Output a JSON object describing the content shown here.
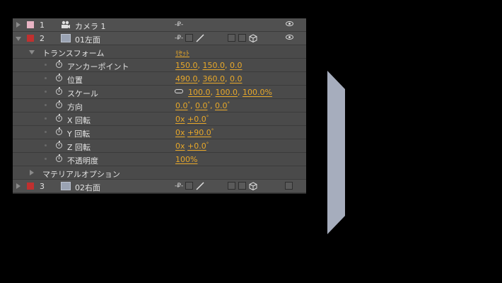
{
  "layers": [
    {
      "num": "1",
      "name": "カメラ 1",
      "label_color": "#e8b4c4"
    },
    {
      "num": "2",
      "name": "01左面",
      "label_color": "#c0302f"
    },
    {
      "num": "3",
      "name": "02右面",
      "label_color": "#c0302f"
    }
  ],
  "transform": {
    "group_label": "トランスフォーム",
    "reset_label": "ﾘｾｯﾄ",
    "anchor": {
      "label": "アンカーポイント",
      "x": "150.0",
      "y": "150.0",
      "z": "0.0"
    },
    "position": {
      "label": "位置",
      "x": "490.0",
      "y": "360.0",
      "z": "0.0"
    },
    "scale": {
      "label": "スケール",
      "x": "100.0",
      "y": "100.0",
      "z": "100.0%"
    },
    "orientation": {
      "label": "方向",
      "x": "0.0",
      "y": "0.0",
      "z": "0.0"
    },
    "xrot": {
      "label": "X 回転",
      "turns": "0x",
      "deg": "+0.0"
    },
    "yrot": {
      "label": "Y 回転",
      "turns": "0x",
      "deg": "+90.0"
    },
    "zrot": {
      "label": "Z 回転",
      "turns": "0x",
      "deg": "+0.0"
    },
    "opacity": {
      "label": "不透明度",
      "value": "100%"
    }
  },
  "material": {
    "label": "マテリアルオプション"
  },
  "sep": {
    "comma": ", "
  },
  "colors": {
    "accent": "#e8a829",
    "panel": "#4a4a4a",
    "shape": "#a6adbd"
  }
}
